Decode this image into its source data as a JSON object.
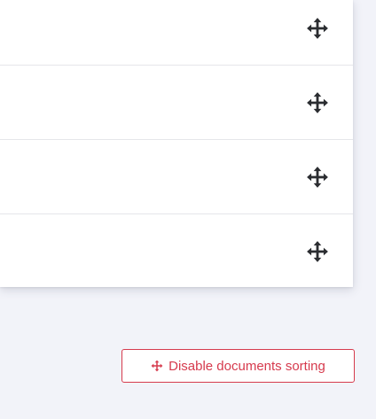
{
  "document_list": {
    "rows": [
      {
        "handle_icon": "move-arrows-icon"
      },
      {
        "handle_icon": "move-arrows-icon"
      },
      {
        "handle_icon": "move-arrows-icon"
      },
      {
        "handle_icon": "move-arrows-icon"
      }
    ]
  },
  "sorting": {
    "button_label": "Disable documents sorting",
    "button_icon": "move-arrows-icon"
  },
  "colors": {
    "accent": "#d63a4d",
    "handle": "#2b2d31",
    "background": "#f2f3f9",
    "panel": "#ffffff",
    "divider": "#e5e6ea"
  }
}
